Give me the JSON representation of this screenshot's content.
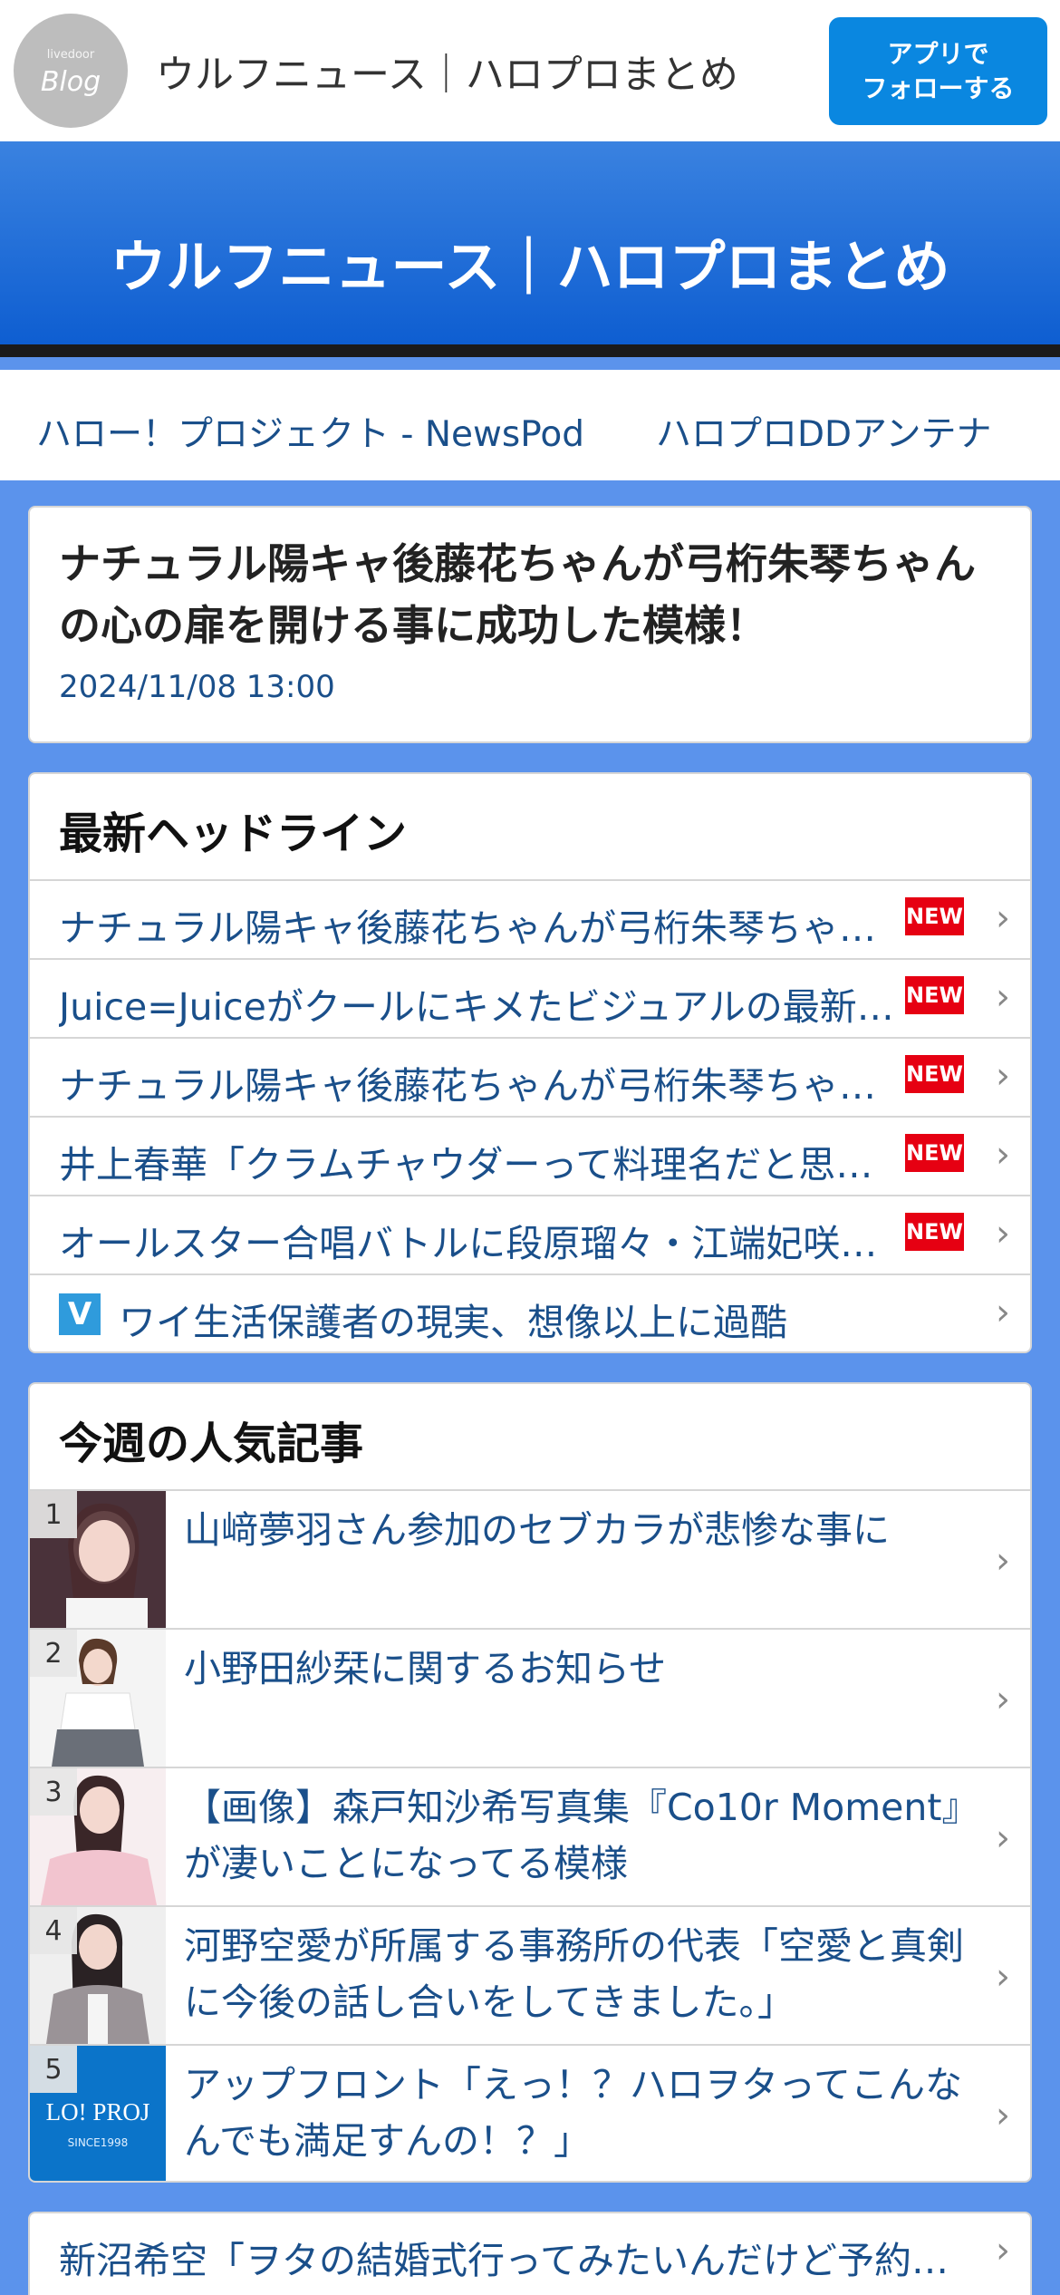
{
  "topbar": {
    "logo_small": "livedoor",
    "logo_big": "Blog",
    "site_name": "ウルフニュース｜ハロプロまとめ",
    "follow_line1": "アプリで",
    "follow_line2": "フォローする"
  },
  "blog": {
    "title": "ウルフニュース｜ハロプロまとめ"
  },
  "links": [
    "ハロー！プロジェクト - NewsPod",
    "ハロプロDDアンテナ"
  ],
  "article": {
    "title": "ナチュラル陽キャ後藤花ちゃんが弓桁朱琴ちゃんの心の扉を開ける事に成功した模様！",
    "date": "2024/11/08 13:00"
  },
  "headlines": {
    "heading": "最新ヘッドライン",
    "new_label": "NEW",
    "items": [
      "ナチュラル陽キャ後藤花ちゃんが弓桁朱琴ちゃんの心の扉を開ける事に成功した模様！",
      "Juice=Juiceがクールにキメたビジュアルの最新カットを公開",
      "ナチュラル陽キャ後藤花ちゃんが弓桁朱琴ちゃんの心の扉を開けた模様",
      "井上春華「クラムチャウダーって料理名だと思ってた」",
      "オールスター合唱バトルに段原瑠々・江端妃咲が出演"
    ],
    "sponsored_icon": "V",
    "sponsored": "ワイ生活保護者の現実、想像以上に過酷"
  },
  "popular": {
    "heading": "今週の人気記事",
    "items": [
      {
        "rank": "1",
        "title": "山﨑夢羽さん参加のセブカラが悲惨な事に"
      },
      {
        "rank": "2",
        "title": "小野田紗栞に関するお知らせ"
      },
      {
        "rank": "3",
        "title": "【画像】森戸知沙希写真集『Co10r Moment』が凄いことになってる模様"
      },
      {
        "rank": "4",
        "title": "河野空愛が所属する事務所の代表「空愛と真剣に今後の話し合いをしてきました。」"
      },
      {
        "rank": "5",
        "title": "アップフロント「えっ！？ハロヲタってこんなんでも満足すんの！？」",
        "thumb_text": "LO! PROJ",
        "thumb_sub": "SINCE1998"
      }
    ]
  },
  "more": {
    "item": "新沼希空「ヲタの結婚式行ってみたいんだけど予約とかしてないの？」"
  },
  "colors": {
    "accent": "#0a87e0",
    "page_bg": "#5b93ec",
    "link": "#1a4f8a",
    "new_badge": "#e60012"
  }
}
